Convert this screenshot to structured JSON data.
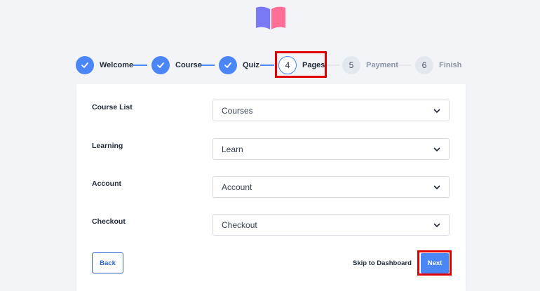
{
  "colors": {
    "accent": "#4a86f6",
    "highlight": "#e00000",
    "background": "#f2f4f8"
  },
  "logo": {
    "icon": "open-book-icon"
  },
  "stepper": {
    "steps": [
      {
        "number": "1",
        "label": "Welcome",
        "state": "done"
      },
      {
        "number": "2",
        "label": "Course",
        "state": "done"
      },
      {
        "number": "3",
        "label": "Quiz",
        "state": "done"
      },
      {
        "number": "4",
        "label": "Pages",
        "state": "current"
      },
      {
        "number": "5",
        "label": "Payment",
        "state": "todo"
      },
      {
        "number": "6",
        "label": "Finish",
        "state": "todo"
      }
    ]
  },
  "form": {
    "rows": [
      {
        "label": "Course List",
        "value": "Courses"
      },
      {
        "label": "Learning",
        "value": "Learn"
      },
      {
        "label": "Account",
        "value": "Account"
      },
      {
        "label": "Checkout",
        "value": "Checkout"
      }
    ]
  },
  "footer": {
    "back_label": "Back",
    "skip_label": "Skip to Dashboard",
    "next_label": "Next"
  }
}
